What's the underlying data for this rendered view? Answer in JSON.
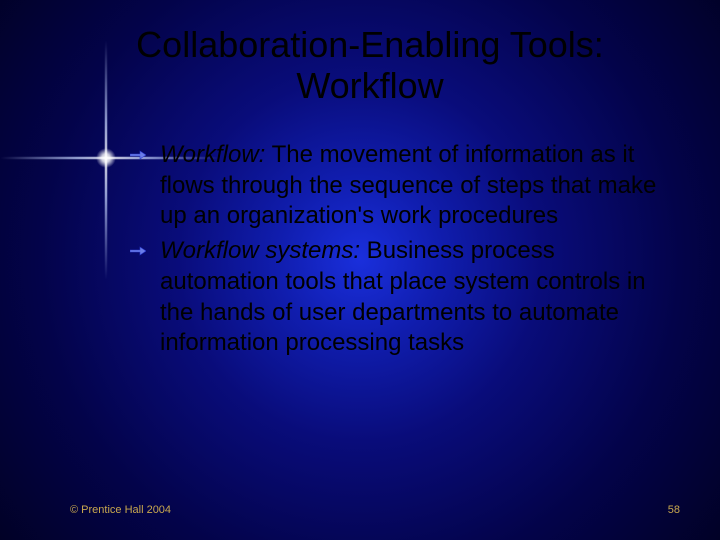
{
  "title": "Collaboration-Enabling Tools: Workflow",
  "bullets": [
    {
      "term": "Workflow:",
      "text": " The movement of information as it flows through the sequence of steps that make up an organization's work procedures"
    },
    {
      "term": "Workflow systems:",
      "text": " Business process automation tools that place system controls in the hands of user departments to automate information processing tasks"
    }
  ],
  "footer": {
    "copyright": "© Prentice Hall 2004",
    "page": "58"
  },
  "colors": {
    "accent": "#c9a84e"
  }
}
